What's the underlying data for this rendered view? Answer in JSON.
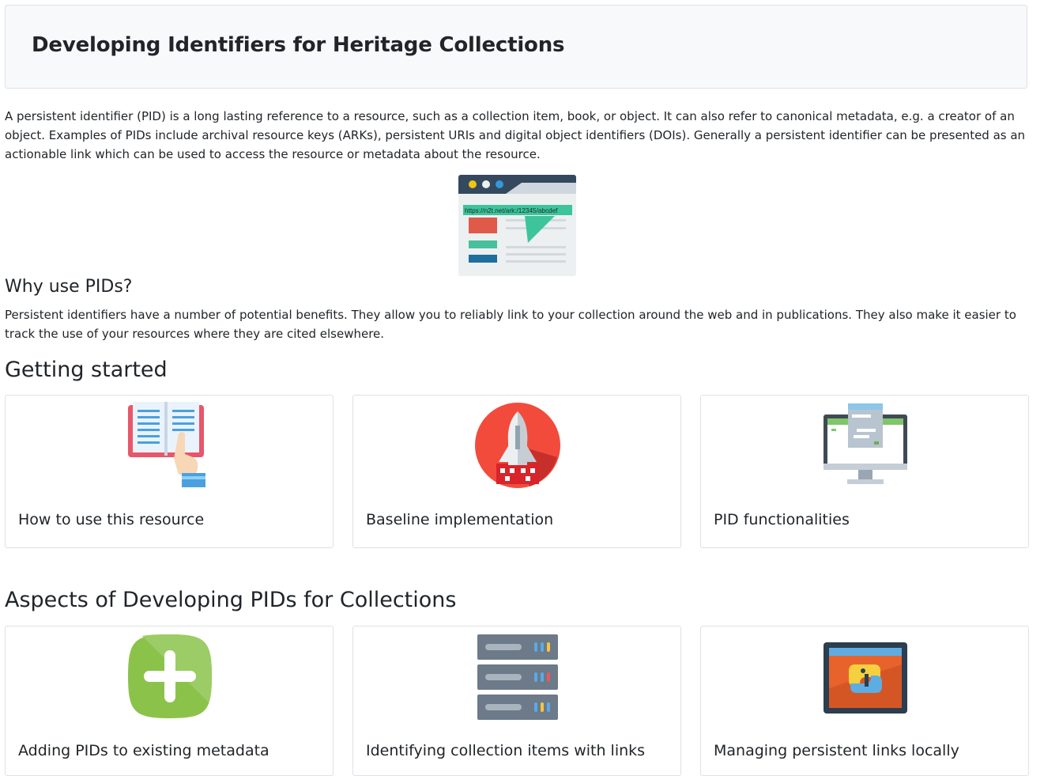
{
  "header": {
    "title": "Developing Identifiers for Heritage Collections"
  },
  "intro": {
    "text": "A persistent identifier (PID) is a long lasting reference to a resource, such as a collection item, book, or object. It can also refer to canonical metadata, e.g. a creator of an object. Examples of PIDs include archival resource keys (ARKs), persistent URIs and digital object identifiers (DOIs). Generally a persistent identifier can be presented as an actionable link which can be used to access the resource or metadata about the resource.",
    "image_url_text": "https://n2t.net/ark:/12345/abcdef"
  },
  "why": {
    "heading": "Why use PIDs?",
    "text": "Persistent identifiers have a number of potential benefits. They allow you to reliably link to your collection around the web and in publications. They also make it easier to track the use of your resources where they are cited elsewhere."
  },
  "getting_started": {
    "heading": "Getting started",
    "cards": [
      {
        "title": "How to use this resource",
        "icon": "open-book-icon"
      },
      {
        "title": "Baseline implementation",
        "icon": "rocket-icon"
      },
      {
        "title": "PID functionalities",
        "icon": "monitor-icon"
      }
    ]
  },
  "aspects": {
    "heading": "Aspects of Developing PIDs for Collections",
    "cards": [
      {
        "title": "Adding PIDs to existing metadata",
        "icon": "plus-icon"
      },
      {
        "title": "Identifying collection items with links",
        "icon": "server-icon"
      },
      {
        "title": "Managing persistent links locally",
        "icon": "python-window-icon"
      }
    ]
  }
}
